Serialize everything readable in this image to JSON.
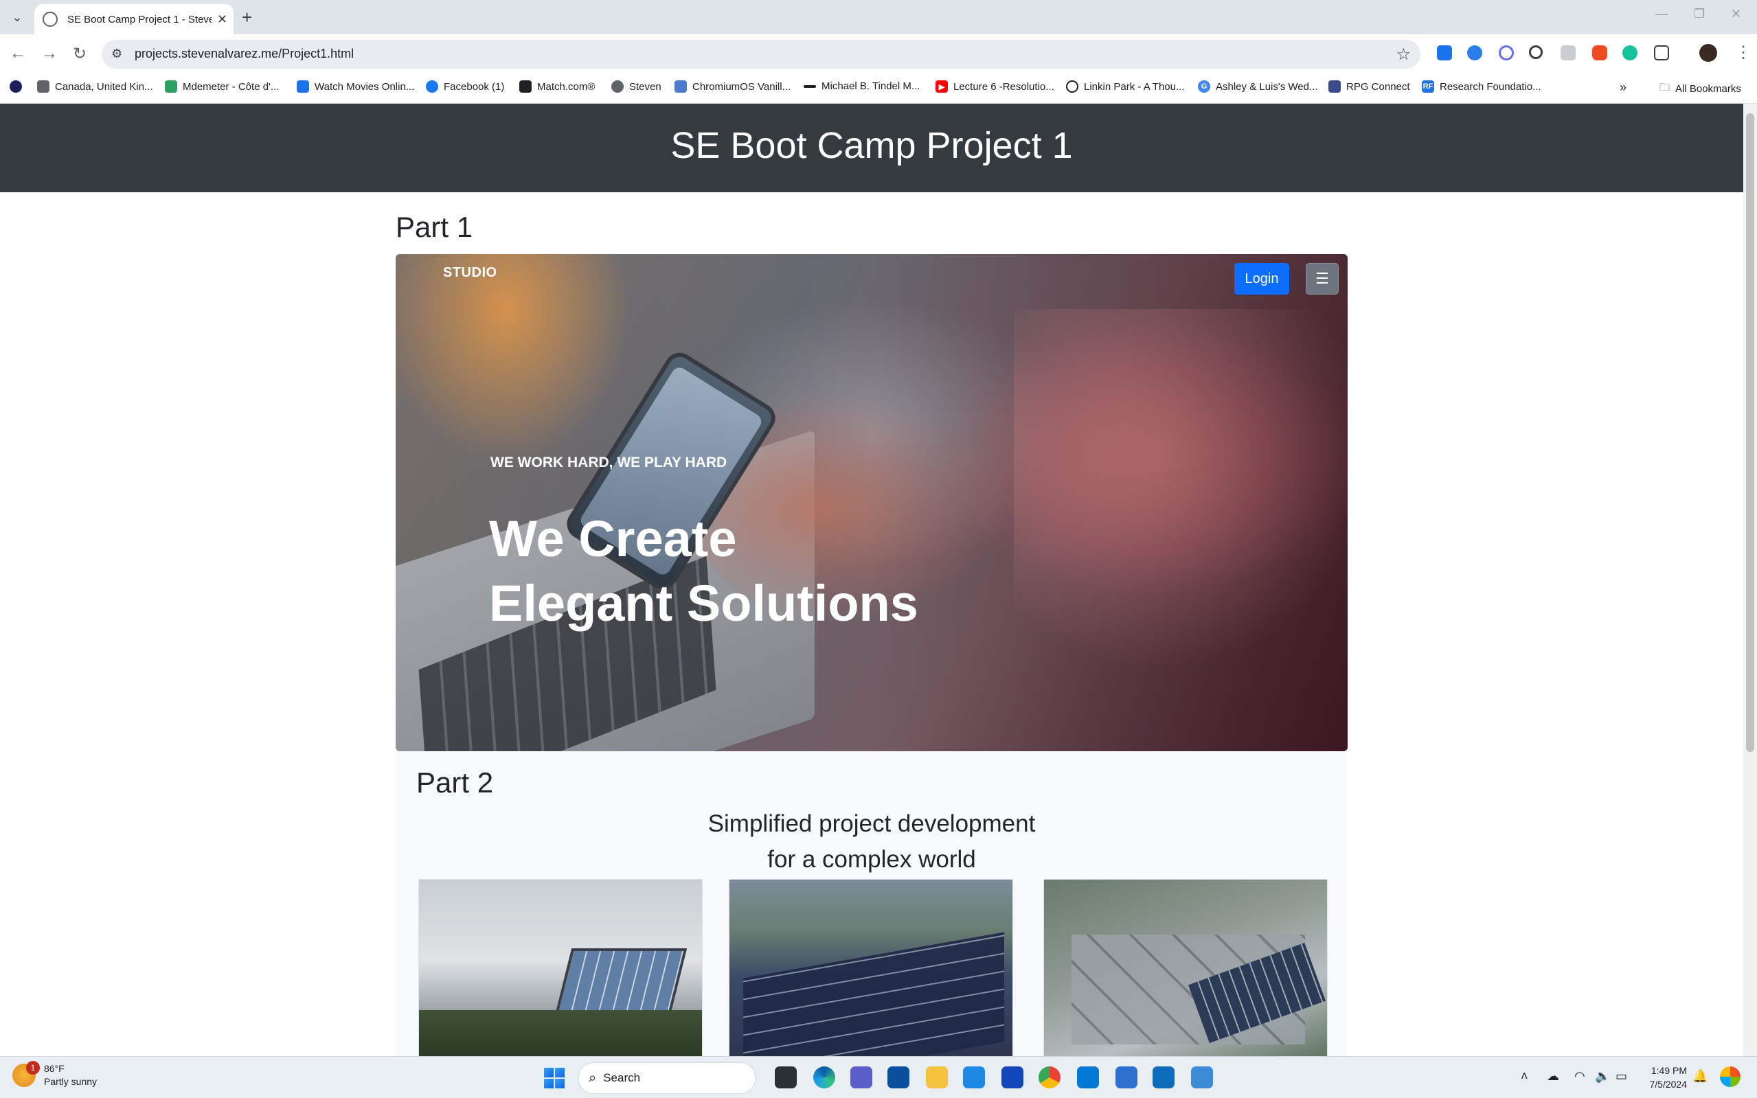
{
  "browser": {
    "tab_title": "SE Boot Camp Project 1 - Steve",
    "url": "projects.stevenalvarez.me/Project1.html",
    "bookmarks": [
      {
        "label": "Canada, United Kin...",
        "color": "#5f6368"
      },
      {
        "label": "Mdemeter - Côte d'...",
        "color": "#2e9f62"
      },
      {
        "label": "Watch Movies Onlin...",
        "color": "#1a73e8"
      },
      {
        "label": "Facebook (1)",
        "color": "#1877f2"
      },
      {
        "label": "Match.com®",
        "color": "#202124"
      },
      {
        "label": "Steven",
        "color": "#5f6368"
      },
      {
        "label": "ChromiumOS Vanill...",
        "color": "#4a7bd0"
      },
      {
        "label": "Michael B. Tindel M...",
        "color": "#202124"
      },
      {
        "label": "Lecture 6 -Resolutio...",
        "color": "#ff0000"
      },
      {
        "label": "Linkin Park - A Thou...",
        "color": "#202124"
      },
      {
        "label": "Ashley & Luis's Wed...",
        "color": "#4285f4"
      },
      {
        "label": "RPG Connect",
        "color": "#3b4a8a"
      },
      {
        "label": "Research Foundatio...",
        "color": "#1a73e8"
      }
    ],
    "all_bookmarks": "All Bookmarks"
  },
  "page": {
    "header_title": "SE Boot Camp Project 1",
    "part1": {
      "title": "Part 1",
      "brand": "STUDIO",
      "login_label": "Login",
      "menu_icon": "☰",
      "tagline": "WE WORK HARD, WE PLAY HARD",
      "headline_line1": "We Create",
      "headline_line2": "Elegant Solutions"
    },
    "part2": {
      "title": "Part 2",
      "subtitle_line1": "Simplified project development",
      "subtitle_line2": "for a complex world"
    }
  },
  "taskbar": {
    "weather_temp": "86°F",
    "weather_desc": "Partly sunny",
    "weather_badge": "1",
    "search_label": "Search",
    "time": "1:49 PM",
    "date": "7/5/2024"
  },
  "colors": {
    "header_bg": "#343a40",
    "login_bg": "#0d6efd",
    "menu_bg": "#6c757d",
    "part2_bg": "#f8f9fa"
  }
}
